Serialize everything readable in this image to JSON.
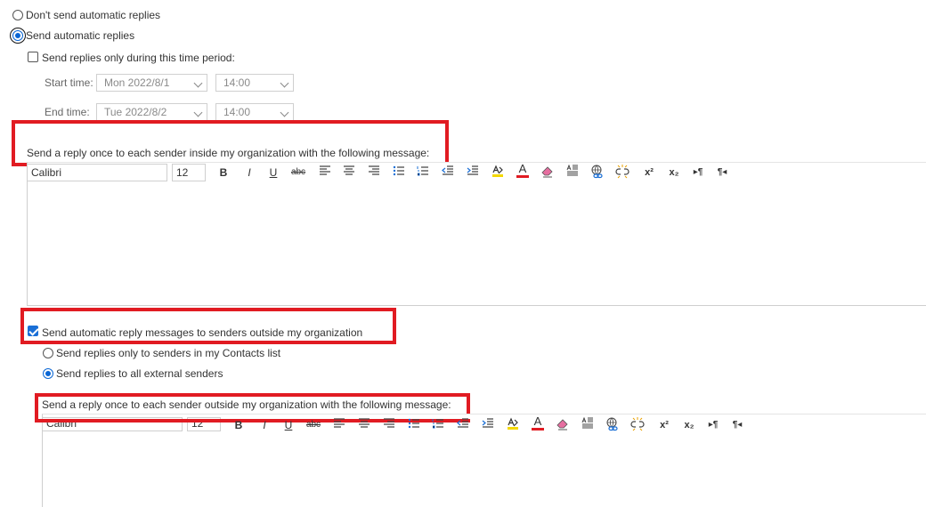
{
  "options": {
    "dont_send": "Don't send automatic replies",
    "send": "Send automatic replies",
    "time_period": "Send replies only during this time period:"
  },
  "schedule": {
    "start_label": "Start time:",
    "start_date": "Mon 2022/8/1",
    "start_time": "14:00",
    "end_label": "End time:",
    "end_date": "Tue 2022/8/2",
    "end_time": "14:00"
  },
  "inside": {
    "message_label": "Send a reply once to each sender inside my organization with the following message:"
  },
  "outside": {
    "enable_label": "Send automatic reply messages to senders outside my organization",
    "contacts_only": "Send replies only to senders in my Contacts list",
    "all_external": "Send replies to all external senders",
    "message_label": "Send a reply once to each sender outside my organization with the following message:"
  },
  "toolbar": {
    "font": "Calibri",
    "size": "12",
    "bold": "B",
    "italic": "I",
    "underline": "U",
    "strike": "abc",
    "superscript": "x²",
    "subscript": "x₂",
    "font_color_label": "A",
    "ltr_label": "▸¶",
    "rtl_label": "¶◂"
  },
  "colors": {
    "accent": "#0a66d4",
    "highlight": "#e11b22"
  }
}
